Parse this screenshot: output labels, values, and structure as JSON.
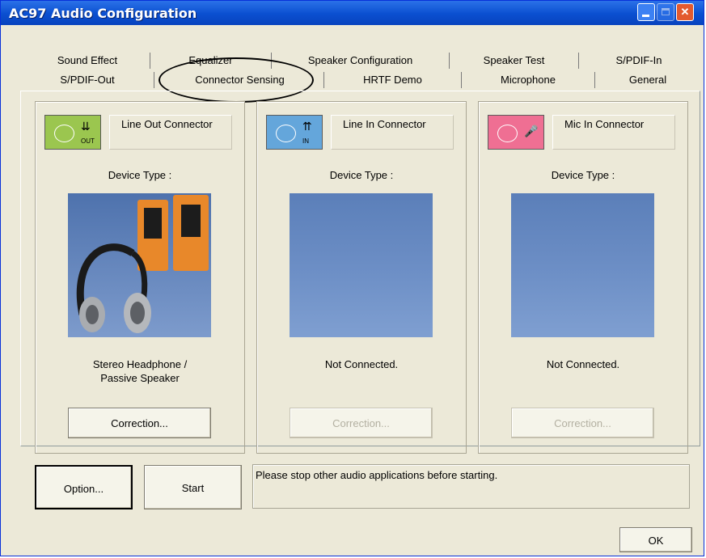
{
  "window": {
    "title": "AC97 Audio Configuration"
  },
  "tabs": {
    "row1": [
      "Sound Effect",
      "Equalizer",
      "Speaker Configuration",
      "Speaker Test",
      "S/PDIF-In"
    ],
    "row2": [
      "S/PDIF-Out",
      "Connector Sensing",
      "HRTF Demo",
      "Microphone",
      "General"
    ],
    "active": "Connector Sensing"
  },
  "panels": [
    {
      "connector": "Line Out Connector",
      "jack_caption": "OUT",
      "device_type_label": "Device Type :",
      "status_line1": "Stereo Headphone /",
      "status_line2": "Passive Speaker",
      "correction_label": "Correction...",
      "color": "#9bc64f"
    },
    {
      "connector": "Line In Connector",
      "jack_caption": "IN",
      "device_type_label": "Device Type :",
      "status_line1": "Not Connected.",
      "status_line2": "",
      "correction_label": "Correction...",
      "color": "#64a6db"
    },
    {
      "connector": "Mic In Connector",
      "jack_caption": "",
      "device_type_label": "Device Type :",
      "status_line1": "Not Connected.",
      "status_line2": "",
      "correction_label": "Correction...",
      "color": "#ef6f93"
    }
  ],
  "buttons": {
    "option": "Option...",
    "start": "Start",
    "ok": "OK"
  },
  "message": "Please stop other audio applications before starting."
}
